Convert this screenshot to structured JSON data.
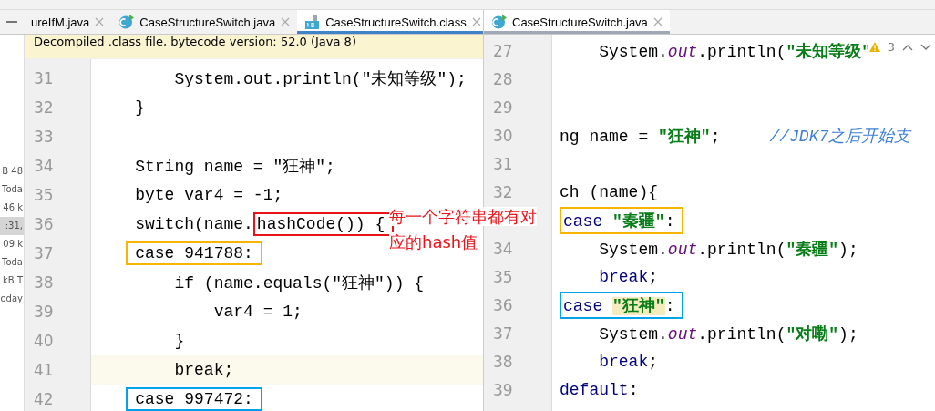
{
  "file_list": [
    {
      "text": "B 48",
      "selected": false
    },
    {
      "text": "Toda",
      "selected": false
    },
    {
      "text": "46 k",
      "selected": false
    },
    {
      "text": ":31,",
      "selected": true
    },
    {
      "text": "09 k",
      "selected": false
    },
    {
      "text": "Toda",
      "selected": false
    },
    {
      "text": "kB T",
      "selected": false
    },
    {
      "text": "oday",
      "selected": false
    }
  ],
  "left_editor": {
    "focused": true,
    "tabs": [
      {
        "label": "ureIfM.java",
        "kind": "plain",
        "selected": false
      },
      {
        "label": "CaseStructureSwitch.java",
        "kind": "java",
        "selected": false
      },
      {
        "label": "CaseStructureSwitch.class",
        "kind": "class",
        "selected": true
      }
    ],
    "banner": "Decompiled .class file, bytecode version: 52.0 (Java 8)",
    "lines": [
      {
        "number": "31",
        "current": false,
        "segments": [
          {
            "kind": "plain",
            "text": "        System.out.println(\"未知等级\");"
          }
        ]
      },
      {
        "number": "32",
        "current": false,
        "segments": [
          {
            "kind": "plain",
            "text": "    }"
          }
        ]
      },
      {
        "number": "33",
        "current": false
      },
      {
        "number": "34",
        "current": false,
        "segments": [
          {
            "kind": "plain",
            "text": "    String name = \"狂神\";"
          }
        ]
      },
      {
        "number": "35",
        "current": false,
        "segments": [
          {
            "kind": "plain",
            "text": "    byte var4 = -1;"
          }
        ]
      },
      {
        "number": "36",
        "current": false,
        "segments": [
          {
            "kind": "plain",
            "text": "    switch(name."
          },
          {
            "kind": "frame",
            "color": "#e8141b",
            "parts": [
              {
                "kind": "plain",
                "text": "hashCode()) {"
              }
            ]
          }
        ]
      },
      {
        "number": "37",
        "current": false,
        "segments": [
          {
            "kind": "frame",
            "color": "#f7b500",
            "parts": [
              {
                "kind": "plain",
                "text": "    case 941788:"
              }
            ]
          }
        ]
      },
      {
        "number": "38",
        "current": false,
        "segments": [
          {
            "kind": "plain",
            "text": "        if (name.equals(\"狂神\")) {"
          }
        ]
      },
      {
        "number": "39",
        "current": false,
        "segments": [
          {
            "kind": "plain",
            "text": "            var4 = 1;"
          }
        ]
      },
      {
        "number": "40",
        "current": false,
        "segments": [
          {
            "kind": "plain",
            "text": "        }"
          }
        ]
      },
      {
        "number": "41",
        "current": true,
        "segments": [
          {
            "kind": "plain",
            "text": "        break;"
          }
        ]
      },
      {
        "number": "42",
        "current": false,
        "segments": [
          {
            "kind": "frame",
            "color": "#00a2e8",
            "parts": [
              {
                "kind": "plain",
                "text": "    case 997472:"
              }
            ]
          }
        ]
      }
    ]
  },
  "right_editor": {
    "focused": false,
    "tabs": [
      {
        "label": "CaseStructureSwitch.java",
        "kind": "java",
        "selected": true
      }
    ],
    "warning_count": "3",
    "lines": [
      {
        "number": "27",
        "current": false,
        "segments": [
          {
            "kind": "plain",
            "text": "    System."
          },
          {
            "kind": "field",
            "text": "out"
          },
          {
            "kind": "plain",
            "text": ".println("
          },
          {
            "kind": "string",
            "text": "\"未知等级\""
          }
        ]
      },
      {
        "number": "28",
        "current": false
      },
      {
        "number": "29",
        "current": false
      },
      {
        "number": "30",
        "current": false,
        "segments": [
          {
            "kind": "plain",
            "text": "ng name = "
          },
          {
            "kind": "string",
            "text": "\"狂神\""
          },
          {
            "kind": "plain",
            "text": ";     "
          },
          {
            "kind": "comment",
            "text": "//JDK7之后开始支"
          }
        ]
      },
      {
        "number": "31",
        "current": false
      },
      {
        "number": "32",
        "current": false,
        "segments": [
          {
            "kind": "plain",
            "text": "ch (name){"
          }
        ]
      },
      {
        "current": false,
        "segments": [
          {
            "kind": "frame",
            "color": "#f7b500",
            "parts": [
              {
                "kind": "keyword",
                "text": "case "
              },
              {
                "kind": "string",
                "text": "\"秦疆\""
              },
              {
                "kind": "plain",
                "text": ":"
              }
            ]
          }
        ]
      },
      {
        "number": "34",
        "current": false,
        "segments": [
          {
            "kind": "plain",
            "text": "    System."
          },
          {
            "kind": "field",
            "text": "out"
          },
          {
            "kind": "plain",
            "text": ".println("
          },
          {
            "kind": "string",
            "text": "\"秦疆\""
          },
          {
            "kind": "plain",
            "text": ");"
          }
        ]
      },
      {
        "number": "35",
        "current": false,
        "segments": [
          {
            "kind": "keyword",
            "text": "    break"
          },
          {
            "kind": "plain",
            "text": ";"
          }
        ]
      },
      {
        "number": "36",
        "current": false,
        "segments": [
          {
            "kind": "frame",
            "color": "#00a2e8",
            "parts": [
              {
                "kind": "keyword",
                "text": "case "
              },
              {
                "kind": "match",
                "text": "\"狂神\""
              },
              {
                "kind": "plain",
                "text": ":"
              }
            ]
          }
        ]
      },
      {
        "number": "37",
        "current": false,
        "segments": [
          {
            "kind": "plain",
            "text": "    System."
          },
          {
            "kind": "field",
            "text": "out"
          },
          {
            "kind": "plain",
            "text": ".println("
          },
          {
            "kind": "string",
            "text": "\"对嘞\""
          },
          {
            "kind": "plain",
            "text": ");"
          }
        ]
      },
      {
        "number": "38",
        "current": false,
        "segments": [
          {
            "kind": "keyword",
            "text": "    break"
          },
          {
            "kind": "plain",
            "text": ";"
          }
        ]
      },
      {
        "number": "39",
        "current": false,
        "segments": [
          {
            "kind": "keyword",
            "text": "default"
          },
          {
            "kind": "plain",
            "text": ":"
          }
        ]
      }
    ]
  },
  "annotation_note": {
    "text": "每一个字符串都有对应的hash值",
    "color": "#e8141b"
  }
}
